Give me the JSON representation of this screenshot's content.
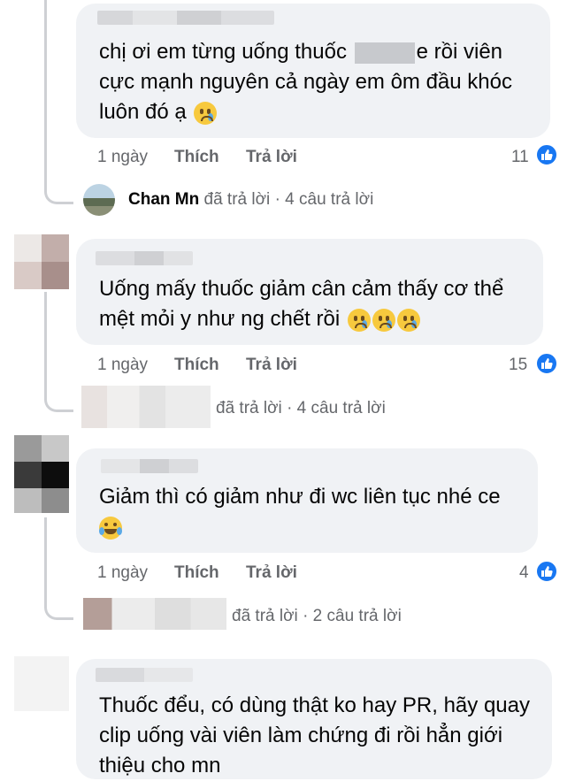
{
  "comments": [
    {
      "text_before": "chị ơi em từng uống thuốc",
      "text_after": "e rồi viên cực mạnh nguyên cả ngày em ôm đầu khóc luôn đó ạ",
      "emoji": "crying-face",
      "time": "1 ngày",
      "like_label": "Thích",
      "reply_label": "Trả lời",
      "reaction_count": "11",
      "reply_summary": {
        "replier_name": "Chan Mn",
        "replied_text": "đã trả lời",
        "separator": "·",
        "reply_count": "4 câu trả lời"
      }
    },
    {
      "text": "Uống mấy thuốc giảm cân cảm thấy cơ thể mệt mỏi y như ng chết rồi",
      "emoji": "crying-face",
      "time": "1 ngày",
      "like_label": "Thích",
      "reply_label": "Trả lời",
      "reaction_count": "15",
      "reply_summary": {
        "replied_text": "đã trả lời",
        "separator": "·",
        "reply_count": "4 câu trả lời"
      }
    },
    {
      "text": "Giảm thì có giảm như đi wc liên tục nhé ce",
      "emoji": "laughing-tears-face",
      "time": "1 ngày",
      "like_label": "Thích",
      "reply_label": "Trả lời",
      "reaction_count": "4",
      "reply_summary": {
        "replied_text": "đã trả lời",
        "separator": "·",
        "reply_count": "2 câu trả lời"
      }
    },
    {
      "text": "Thuốc đểu, có dùng thật ko hay PR, hãy quay clip uống vài viên làm chứng đi rồi hẳn giới thiệu cho mn"
    }
  ],
  "colors": {
    "bubble": "#f0f2f5",
    "secondary_text": "#65676b",
    "like_blue": "#1877f2",
    "thread_line": "#ced0d4"
  }
}
